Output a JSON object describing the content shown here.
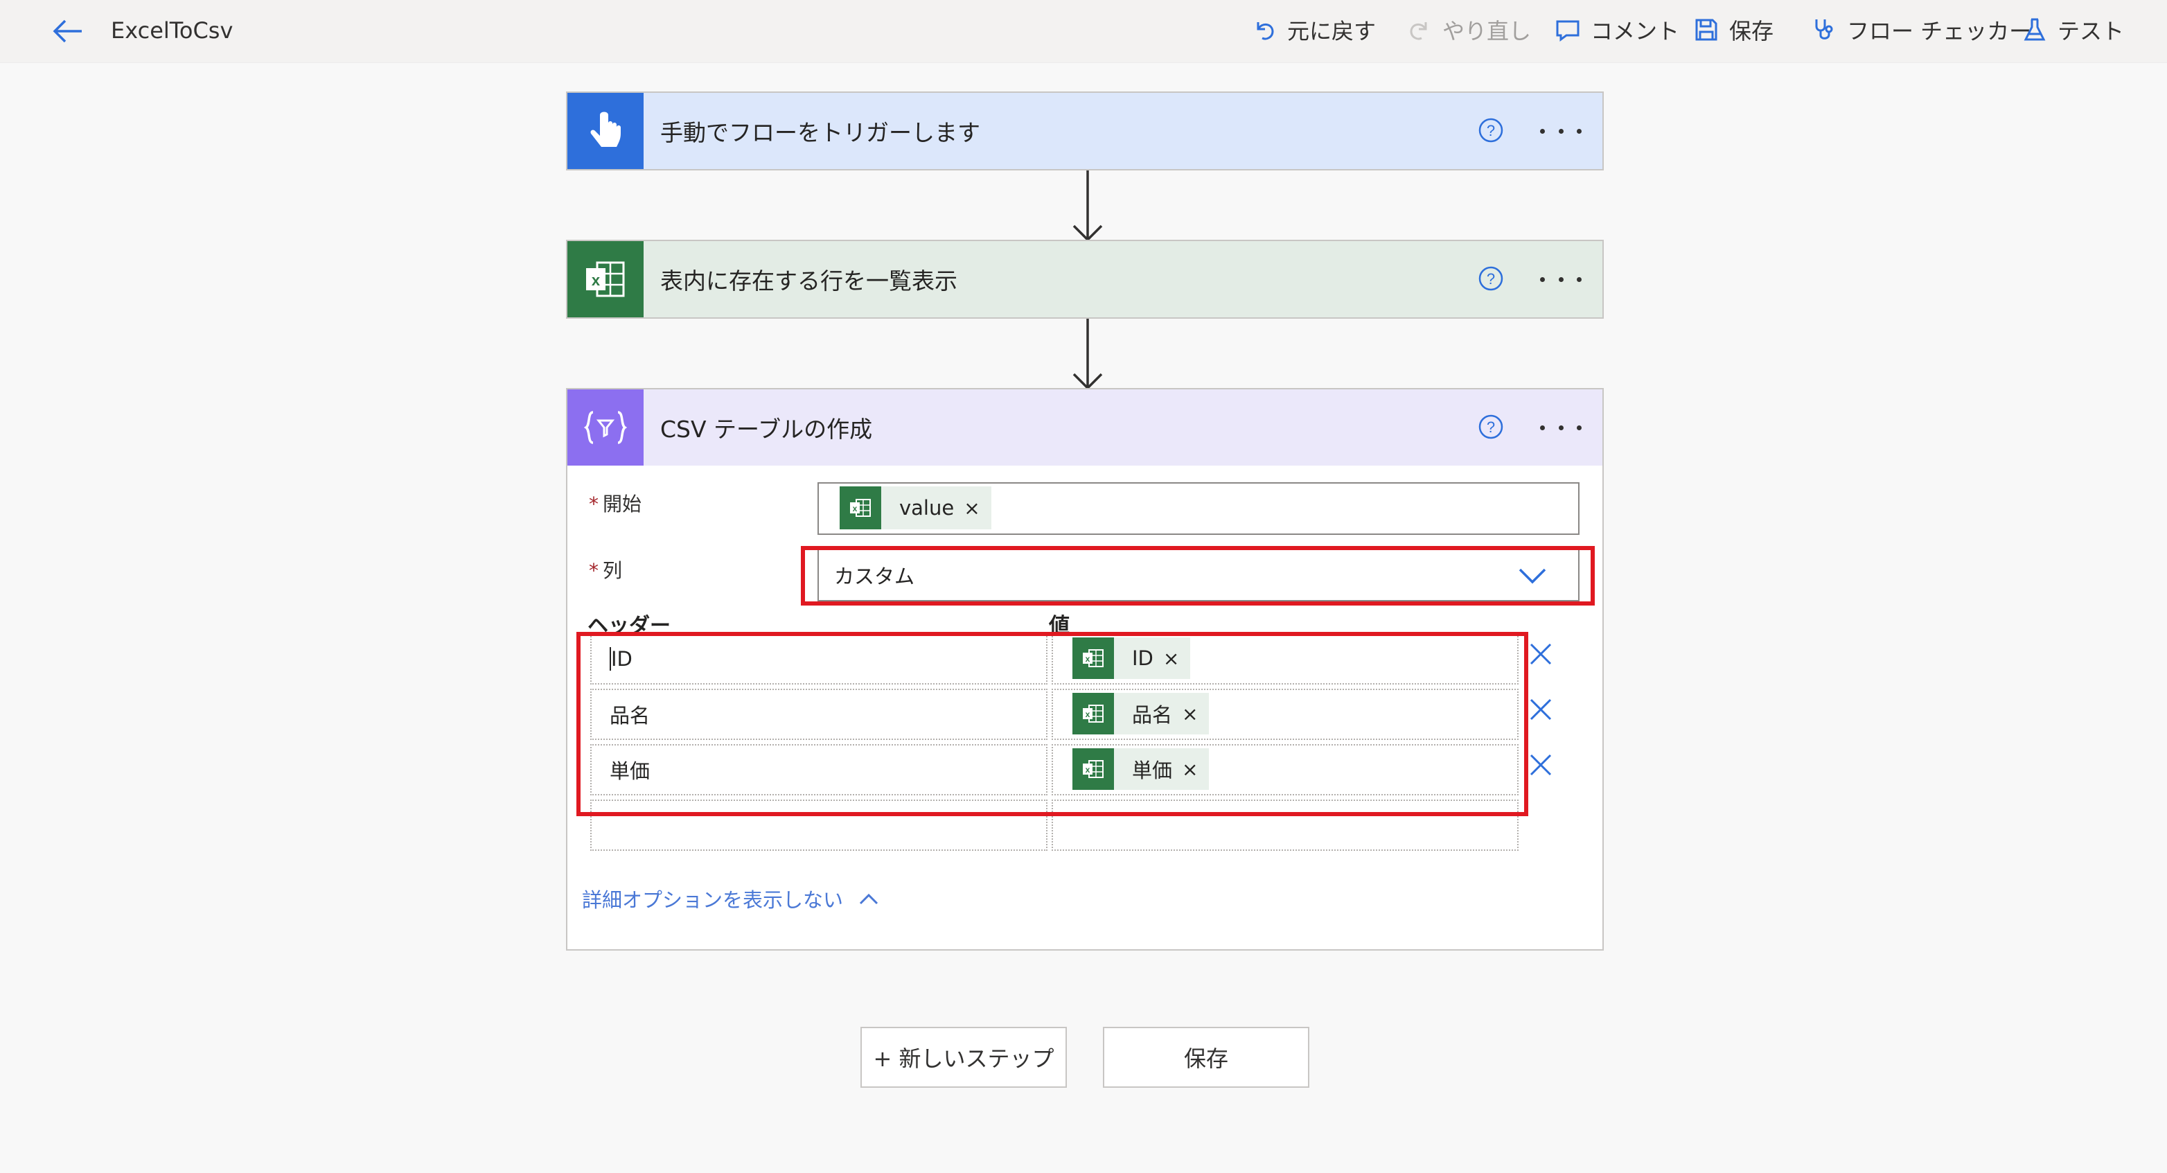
{
  "header": {
    "title": "ExcelToCsv",
    "undo": "元に戻す",
    "redo": "やり直し",
    "comment": "コメント",
    "save": "保存",
    "flow_checker": "フロー チェッカー",
    "test": "テスト"
  },
  "steps": [
    {
      "title": "手動でフローをトリガーします",
      "accent": "#dce7fb",
      "icon_bg": "#2e6fdb"
    },
    {
      "title": "表内に存在する行を一覧表示",
      "accent": "#e3ece5",
      "icon_bg": "#2f7b46"
    },
    {
      "title": "CSV テーブルの作成",
      "accent": "#ebe8fa",
      "icon_bg": "#8c6ff0"
    }
  ],
  "csv": {
    "from_label": "開始",
    "from_token": "value",
    "columns_label": "列",
    "columns_value": "カスタム",
    "header_col": "ヘッダー",
    "value_col": "値",
    "rows": [
      {
        "header": "ID",
        "value": "ID"
      },
      {
        "header": "品名",
        "value": "品名"
      },
      {
        "header": "単価",
        "value": "単価"
      }
    ],
    "advanced_link": "詳細オプションを表示しない"
  },
  "footer": {
    "new_step": "+ 新しいステップ",
    "save": "保存"
  },
  "colors": {
    "highlight": "#e01921",
    "link": "#4a78d6",
    "excel_green": "#2f7b46"
  }
}
